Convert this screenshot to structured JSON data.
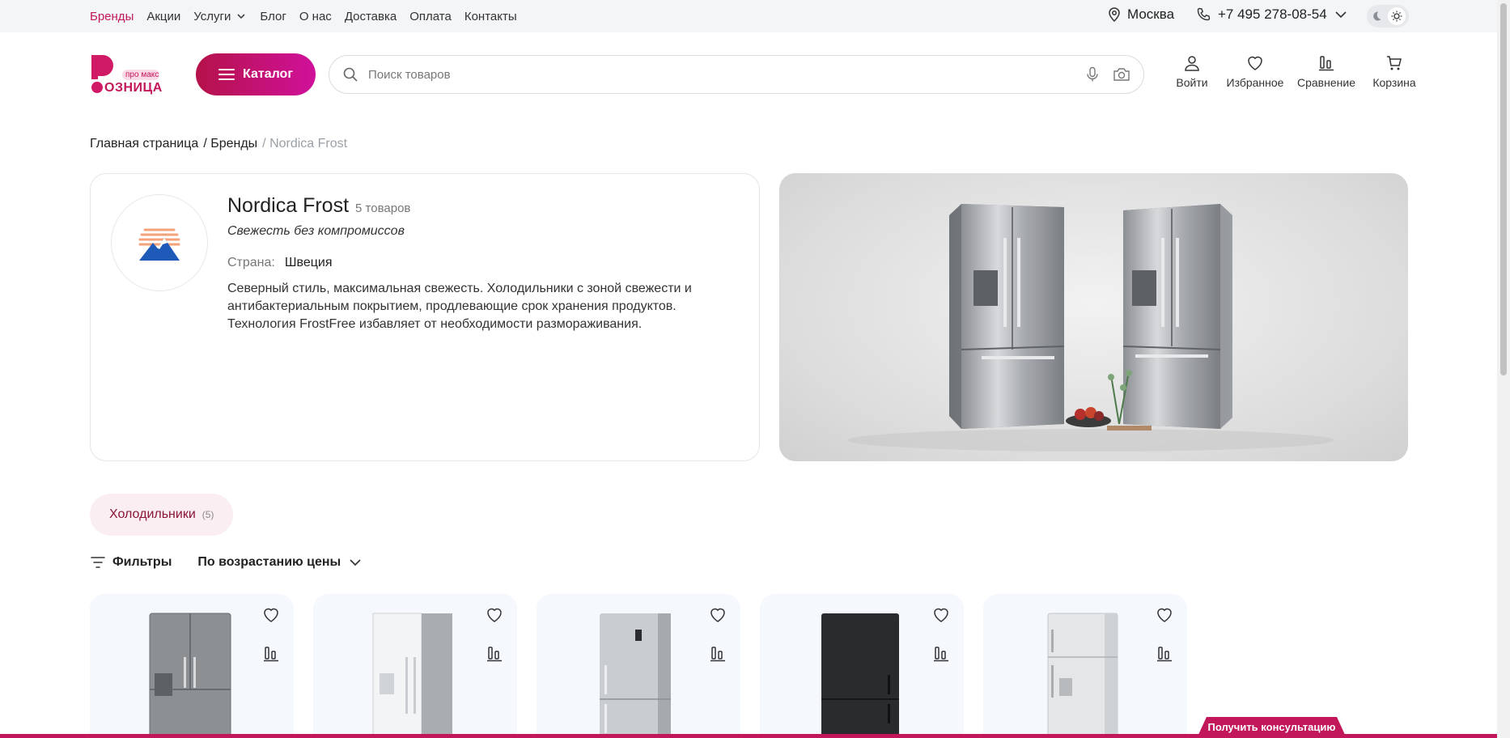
{
  "topbar": {
    "nav": [
      {
        "label": "Бренды",
        "active": true
      },
      {
        "label": "Акции"
      },
      {
        "label": "Услуги",
        "dropdown": true
      },
      {
        "label": "Блог"
      },
      {
        "label": "О нас"
      },
      {
        "label": "Доставка"
      },
      {
        "label": "Оплата"
      },
      {
        "label": "Контакты"
      }
    ],
    "city": "Москва",
    "phone": "+7 495 278-08-54"
  },
  "header": {
    "logo_tagline": "про макс",
    "logo_word": "ОЗНИЦА",
    "catalog_label": "Каталог",
    "search_placeholder": "Поиск товаров",
    "actions": {
      "login": "Войти",
      "favorites": "Избранное",
      "compare": "Сравнение",
      "cart": "Корзина"
    }
  },
  "breadcrumb": {
    "home": "Главная страница",
    "brands": "/ Бренды",
    "current": "/ Nordica Frost"
  },
  "brand": {
    "name": "Nordica Frost",
    "count": "5 товаров",
    "slogan": "Свежесть без компромиссов",
    "country_label": "Страна:",
    "country": "Швеция",
    "description": "Северный стиль, максимальная свежесть. Холодильники с зоной свежести и антибактериальным покрытием, продлевающие срок хранения продуктов. Технология FrostFree избавляет от необходимости размораживания."
  },
  "category_chip": {
    "label": "Холодильники",
    "count": "(5)"
  },
  "filters": {
    "filters_label": "Фильтры",
    "sort_label": "По возрастанию цены"
  },
  "products": [
    {
      "color": "#8d9093",
      "style": "side"
    },
    {
      "color": "#eef0f2",
      "style": "side-white"
    },
    {
      "color": "#c9ccd0",
      "style": "single"
    },
    {
      "color": "#2a2b2d",
      "style": "black"
    },
    {
      "color": "#e4e6e8",
      "style": "top"
    }
  ],
  "consult_button": "Получить консультацию",
  "colors": {
    "accent": "#c2185b",
    "catalog_gradient_start": "#b5124a",
    "catalog_gradient_end": "#d0119a",
    "chip_bg": "#fbeef2"
  }
}
